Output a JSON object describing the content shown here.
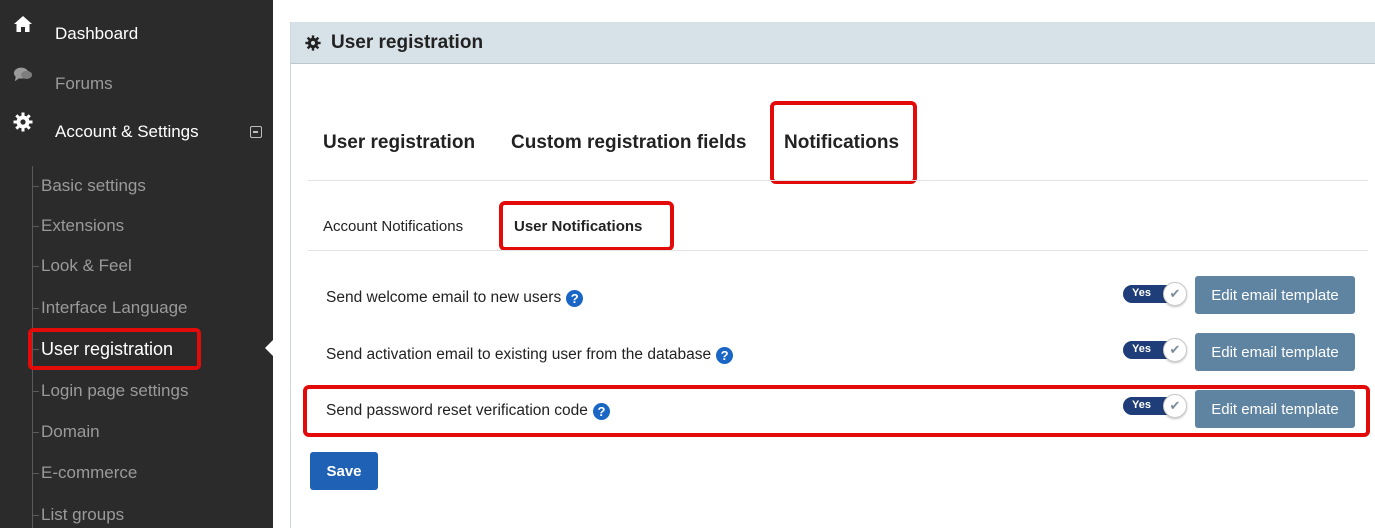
{
  "sidebar": {
    "top_items": [
      {
        "label": "Dashboard",
        "icon": "home-icon"
      },
      {
        "label": "Forums",
        "icon": "chat-bubbles-icon"
      },
      {
        "label": "Account & Settings",
        "icon": "gear-icon"
      }
    ],
    "sub_items": [
      {
        "label": "Basic settings"
      },
      {
        "label": "Extensions"
      },
      {
        "label": "Look & Feel"
      },
      {
        "label": "Interface Language"
      },
      {
        "label": "User registration"
      },
      {
        "label": "Login page settings"
      },
      {
        "label": "Domain"
      },
      {
        "label": "E-commerce"
      },
      {
        "label": "List groups"
      }
    ]
  },
  "panel": {
    "title": "User registration"
  },
  "tabs": [
    {
      "label": "User registration"
    },
    {
      "label": "Custom registration fields"
    },
    {
      "label": "Notifications"
    }
  ],
  "subtabs": [
    {
      "label": "Account Notifications"
    },
    {
      "label": "User Notifications"
    }
  ],
  "rows": [
    {
      "label": "Send welcome email to new users",
      "toggle": "Yes",
      "button": "Edit email template"
    },
    {
      "label": "Send activation email to existing user from the database",
      "toggle": "Yes",
      "button": "Edit email template"
    },
    {
      "label": "Send password reset verification code",
      "toggle": "Yes",
      "button": "Edit email template"
    }
  ],
  "save_label": "Save",
  "colors": {
    "sidebar_bg": "#2b2b2b",
    "highlight_red": "#e30a0a",
    "primary_blue": "#1f61b5",
    "button_steel": "#5f84a2",
    "toggle_navy": "#1f3d78"
  }
}
